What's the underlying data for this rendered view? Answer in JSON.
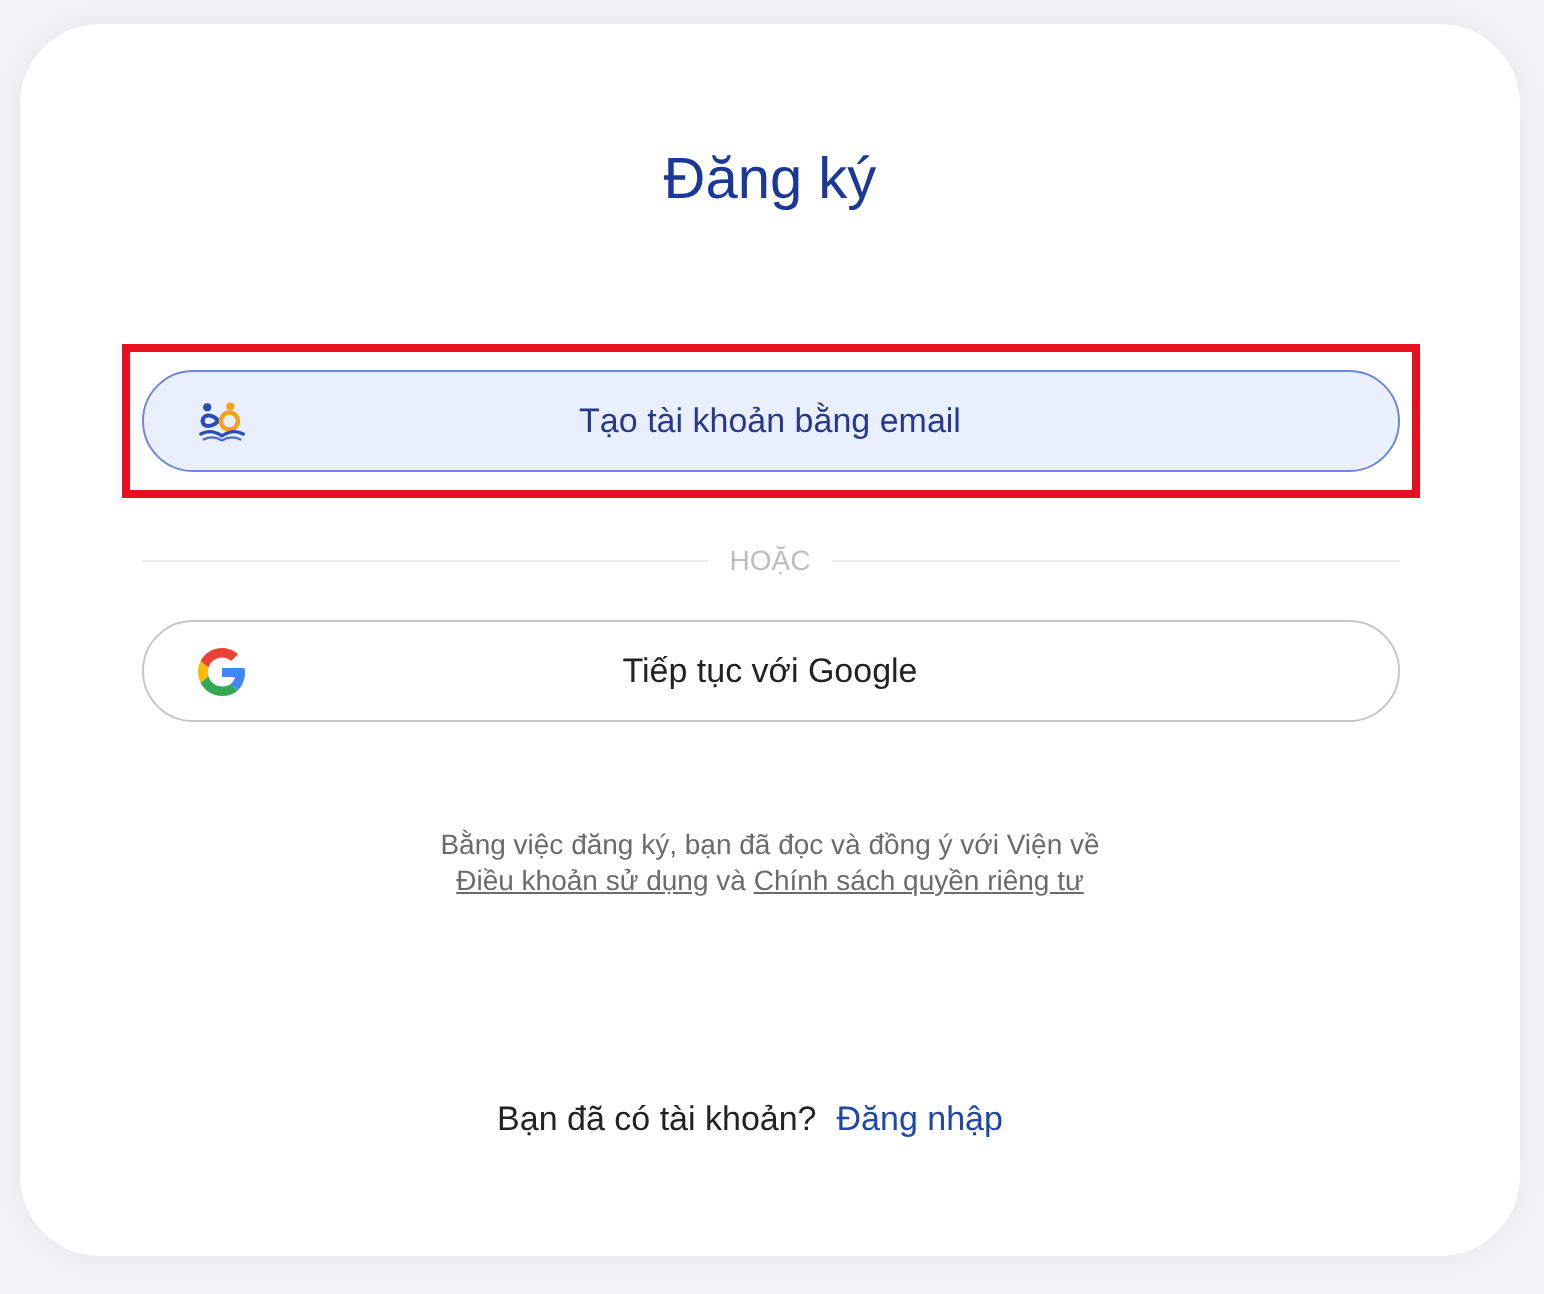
{
  "title": "Đăng ký",
  "email_button": {
    "label": "Tạo tài khoản bằng email",
    "highlighted": true
  },
  "divider": {
    "label": "HOẶC"
  },
  "google_button": {
    "label": "Tiếp tục với Google",
    "highlighted": false
  },
  "terms": {
    "text": "Bằng việc đăng ký, bạn đã đọc và đồng ý với Viện về",
    "links": [
      "Điều khoản sử dụng",
      "Chính sách quyền riêng tư"
    ],
    "connector": "và"
  },
  "login_prompt": {
    "text": "Bạn đã có tài khoản?",
    "link": "Đăng nhập"
  }
}
